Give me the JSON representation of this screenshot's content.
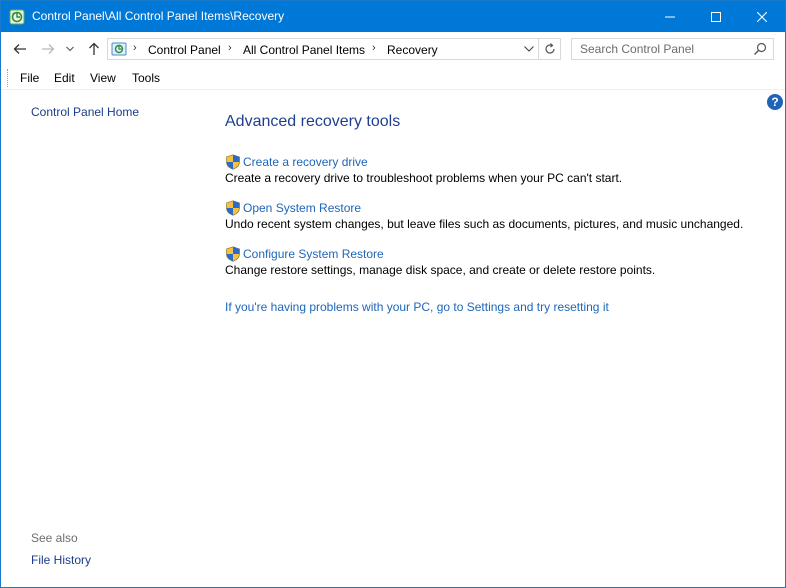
{
  "window": {
    "title": "Control Panel\\All Control Panel Items\\Recovery"
  },
  "address_bar": {
    "breadcrumbs": [
      "Control Panel",
      "All Control Panel Items",
      "Recovery"
    ],
    "search_placeholder": "Search Control Panel"
  },
  "menu": {
    "items": [
      "File",
      "Edit",
      "View",
      "Tools"
    ]
  },
  "sidebar": {
    "home_link": "Control Panel Home",
    "see_also_label": "See also",
    "see_also_links": [
      "File History"
    ]
  },
  "main": {
    "heading": "Advanced recovery tools",
    "tasks": [
      {
        "link": "Create a recovery drive",
        "description": "Create a recovery drive to troubleshoot problems when your PC can't start."
      },
      {
        "link": "Open System Restore",
        "description": "Undo recent system changes, but leave files such as documents, pictures, and music unchanged."
      },
      {
        "link": "Configure System Restore",
        "description": "Change restore settings, manage disk space, and create or delete restore points."
      }
    ],
    "reset_link": "If you're having problems with your PC, go to Settings and try resetting it"
  },
  "icons": {
    "app": "recovery-icon",
    "task": "uac-shield-icon",
    "help": "help-icon"
  },
  "colors": {
    "titlebar": "#0078d7",
    "heading": "#1e3f91",
    "link": "#1e66b8"
  }
}
